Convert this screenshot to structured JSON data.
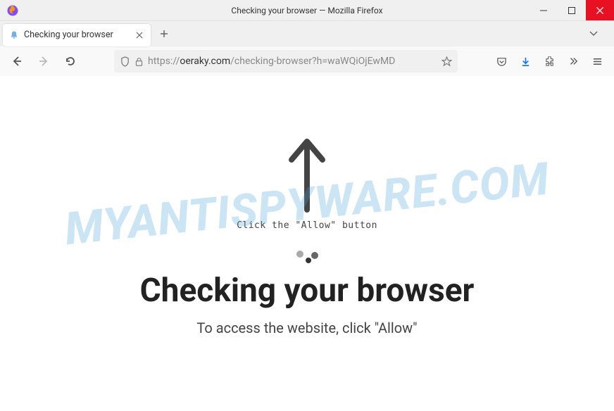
{
  "window": {
    "title": "Checking your browser — Mozilla Firefox"
  },
  "tab": {
    "title": "Checking your browser"
  },
  "url": {
    "protocol": "https://",
    "domain": "oeraky.com",
    "path": "/checking-browser?h=waWQiOjEwMD"
  },
  "page": {
    "click_allow": "Click the \"Allow\" button",
    "heading": "Checking your browser",
    "subheading": "To access the website, click \"Allow\""
  },
  "watermark": "MYANTISPYWARE.COM"
}
